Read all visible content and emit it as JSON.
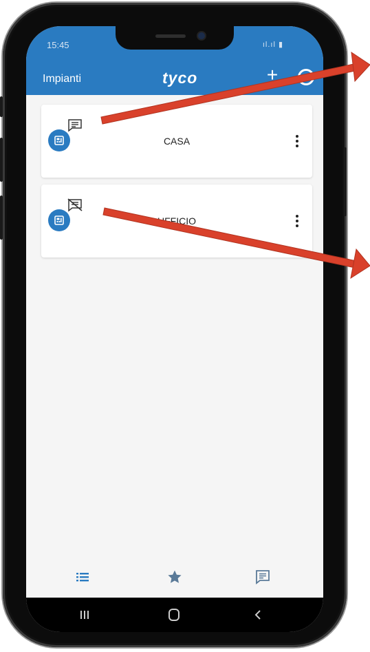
{
  "status_bar": {
    "time": "15:45",
    "icons": "ıl.ıl ▮"
  },
  "app_bar": {
    "title": "Impianti",
    "logo": "tyco",
    "add_label": "+"
  },
  "installations": [
    {
      "name": "CASA",
      "messages_state": "messages-available"
    },
    {
      "name": "UFFICIO",
      "messages_state": "messages-disabled"
    }
  ],
  "bottom_nav": {
    "items": [
      "list-icon",
      "star-icon",
      "message-list-icon"
    ],
    "active": "list-icon"
  },
  "system_nav": {
    "items": [
      "recent-apps-icon",
      "home-icon",
      "back-icon"
    ]
  },
  "colors": {
    "primary": "#2a7bc1",
    "annotation_arrow": "#d9412b",
    "nav_icon": "#5a7a98"
  }
}
